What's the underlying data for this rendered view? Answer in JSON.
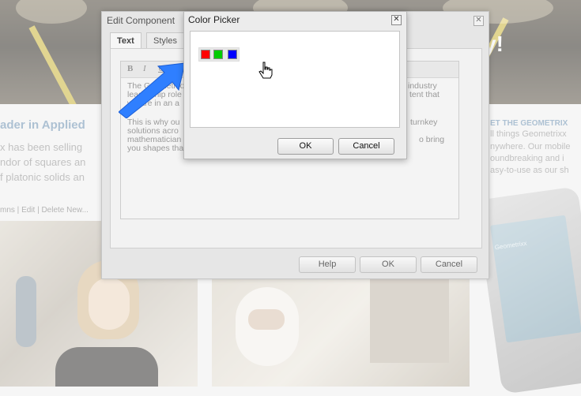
{
  "page": {
    "headline_fragment": "ader in Applied",
    "body_lines": [
      "x has been selling",
      "ndor of squares an",
      "f platonic solids an"
    ],
    "hero_fragment": "y!",
    "edit_bar": {
      "columns": "mns",
      "edit": "Edit",
      "delete": "Delete",
      "new": "New..."
    },
    "right_column": {
      "heading": "ET THE GEOMETRIX",
      "lines": [
        "ll things Geometrixx",
        "nywhere. Our mobile",
        "oundbreaking and i",
        "asy-to-use as our sh"
      ]
    },
    "phone_brand": "Geometrixx"
  },
  "edit_dialog": {
    "title": "Edit Component",
    "close_glyph": "✕",
    "tabs": [
      "Text",
      "Styles"
    ],
    "toolbar": {
      "bold": "B",
      "italic": "I",
      "underline": "U"
    },
    "paragraph1": [
      "The Geometrixx",
      "industry",
      "leadership role",
      "tent that",
      "we are in an a"
    ],
    "paragraph2": [
      "This is why ou",
      "turnkey",
      "solutions acro",
      "mathematician",
      "o bring",
      "you shapes that are unthinkabletoday."
    ],
    "buttons": {
      "help": "Help",
      "ok": "OK",
      "cancel": "Cancel"
    }
  },
  "color_picker": {
    "title": "Color Picker",
    "close_glyph": "✕",
    "swatches": [
      {
        "name": "red",
        "color": "#ff0000"
      },
      {
        "name": "green",
        "color": "#00cc00"
      },
      {
        "name": "blue",
        "color": "#0000ff"
      }
    ],
    "ok": "OK",
    "cancel": "Cancel"
  },
  "colors": {
    "accent_blue": "#2f7fff",
    "heading_blue": "#6b8fb0"
  }
}
